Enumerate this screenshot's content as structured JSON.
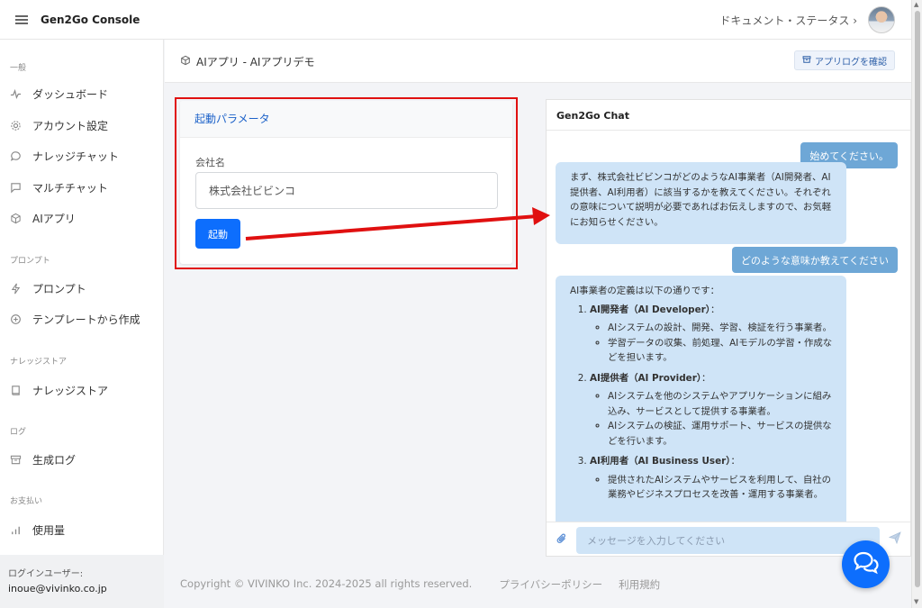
{
  "header": {
    "brand": "Gen2Go Console",
    "top_menu": "ドキュメント・ステータス ›"
  },
  "sidebar": {
    "sections": [
      {
        "title": "一般",
        "items": [
          {
            "label": "ダッシュボード",
            "icon": "activity-icon"
          },
          {
            "label": "アカウント設定",
            "icon": "gear-icon"
          },
          {
            "label": "ナレッジチャット",
            "icon": "chat-bubble-icon"
          },
          {
            "label": "マルチチャット",
            "icon": "message-square-icon"
          },
          {
            "label": "AIアプリ",
            "icon": "cube-icon"
          }
        ]
      },
      {
        "title": "プロンプト",
        "items": [
          {
            "label": "プロンプト",
            "icon": "lightning-icon"
          },
          {
            "label": "テンプレートから作成",
            "icon": "plus-circle-icon"
          }
        ]
      },
      {
        "title": "ナレッジストア",
        "items": [
          {
            "label": "ナレッジストア",
            "icon": "book-icon"
          }
        ]
      },
      {
        "title": "ログ",
        "items": [
          {
            "label": "生成ログ",
            "icon": "archive-icon"
          }
        ]
      },
      {
        "title": "お支払い",
        "items": [
          {
            "label": "使用量",
            "icon": "bar-chart-icon"
          }
        ]
      }
    ],
    "login_caption": "ログインユーザー:",
    "login_email": "inoue@vivinko.co.jp"
  },
  "page": {
    "title": "AIアプリ - AIアプリデモ",
    "log_button": "アプリログを確認"
  },
  "params": {
    "title": "起動パラメータ",
    "field_label": "会社名",
    "field_value": "株式会社ビビンコ",
    "start_button": "起動"
  },
  "chat": {
    "title": "Gen2Go Chat",
    "user_msg_1": "始めてください。",
    "ai_msg_1": "まず、株式会社ビビンコがどのようなAI事業者（AI開発者、AI提供者、AI利用者）に該当するかを教えてください。それぞれの意味について説明が必要であればお伝えしますので、お気軽にお知らせください。",
    "user_msg_2": "どのような意味か教えてください",
    "ai_intro": "AI事業者の定義は以下の通りです：",
    "ai_items": [
      {
        "title": "AI開発者（AI Developer）",
        "bullets": [
          "AIシステムの設計、開発、学習、検証を行う事業者。",
          "学習データの収集、前処理、AIモデルの学習・作成などを担います。"
        ]
      },
      {
        "title": "AI提供者（AI Provider）",
        "bullets": [
          "AIシステムを他のシステムやアプリケーションに組み込み、サービスとして提供する事業者。",
          "AIシステムの検証、運用サポート、サービスの提供などを行います。"
        ]
      },
      {
        "title": "AI利用者（AI Business User）",
        "bullets": [
          "提供されたAIシステムやサービスを利用して、自社の業務やビジネスプロセスを改善・運用する事業者。"
        ]
      }
    ],
    "input_placeholder": "メッセージを入力してください"
  },
  "footer": {
    "copyright": "Copyright © VIVINKO Inc. 2024-2025 all rights reserved.",
    "privacy": "プライバシーポリシー",
    "terms": "利用規約"
  },
  "colors": {
    "accent": "#0d6efd",
    "annotation_red": "#e01010",
    "user_bubble": "#6ea7d6",
    "ai_bubble": "#cfe4f7"
  }
}
